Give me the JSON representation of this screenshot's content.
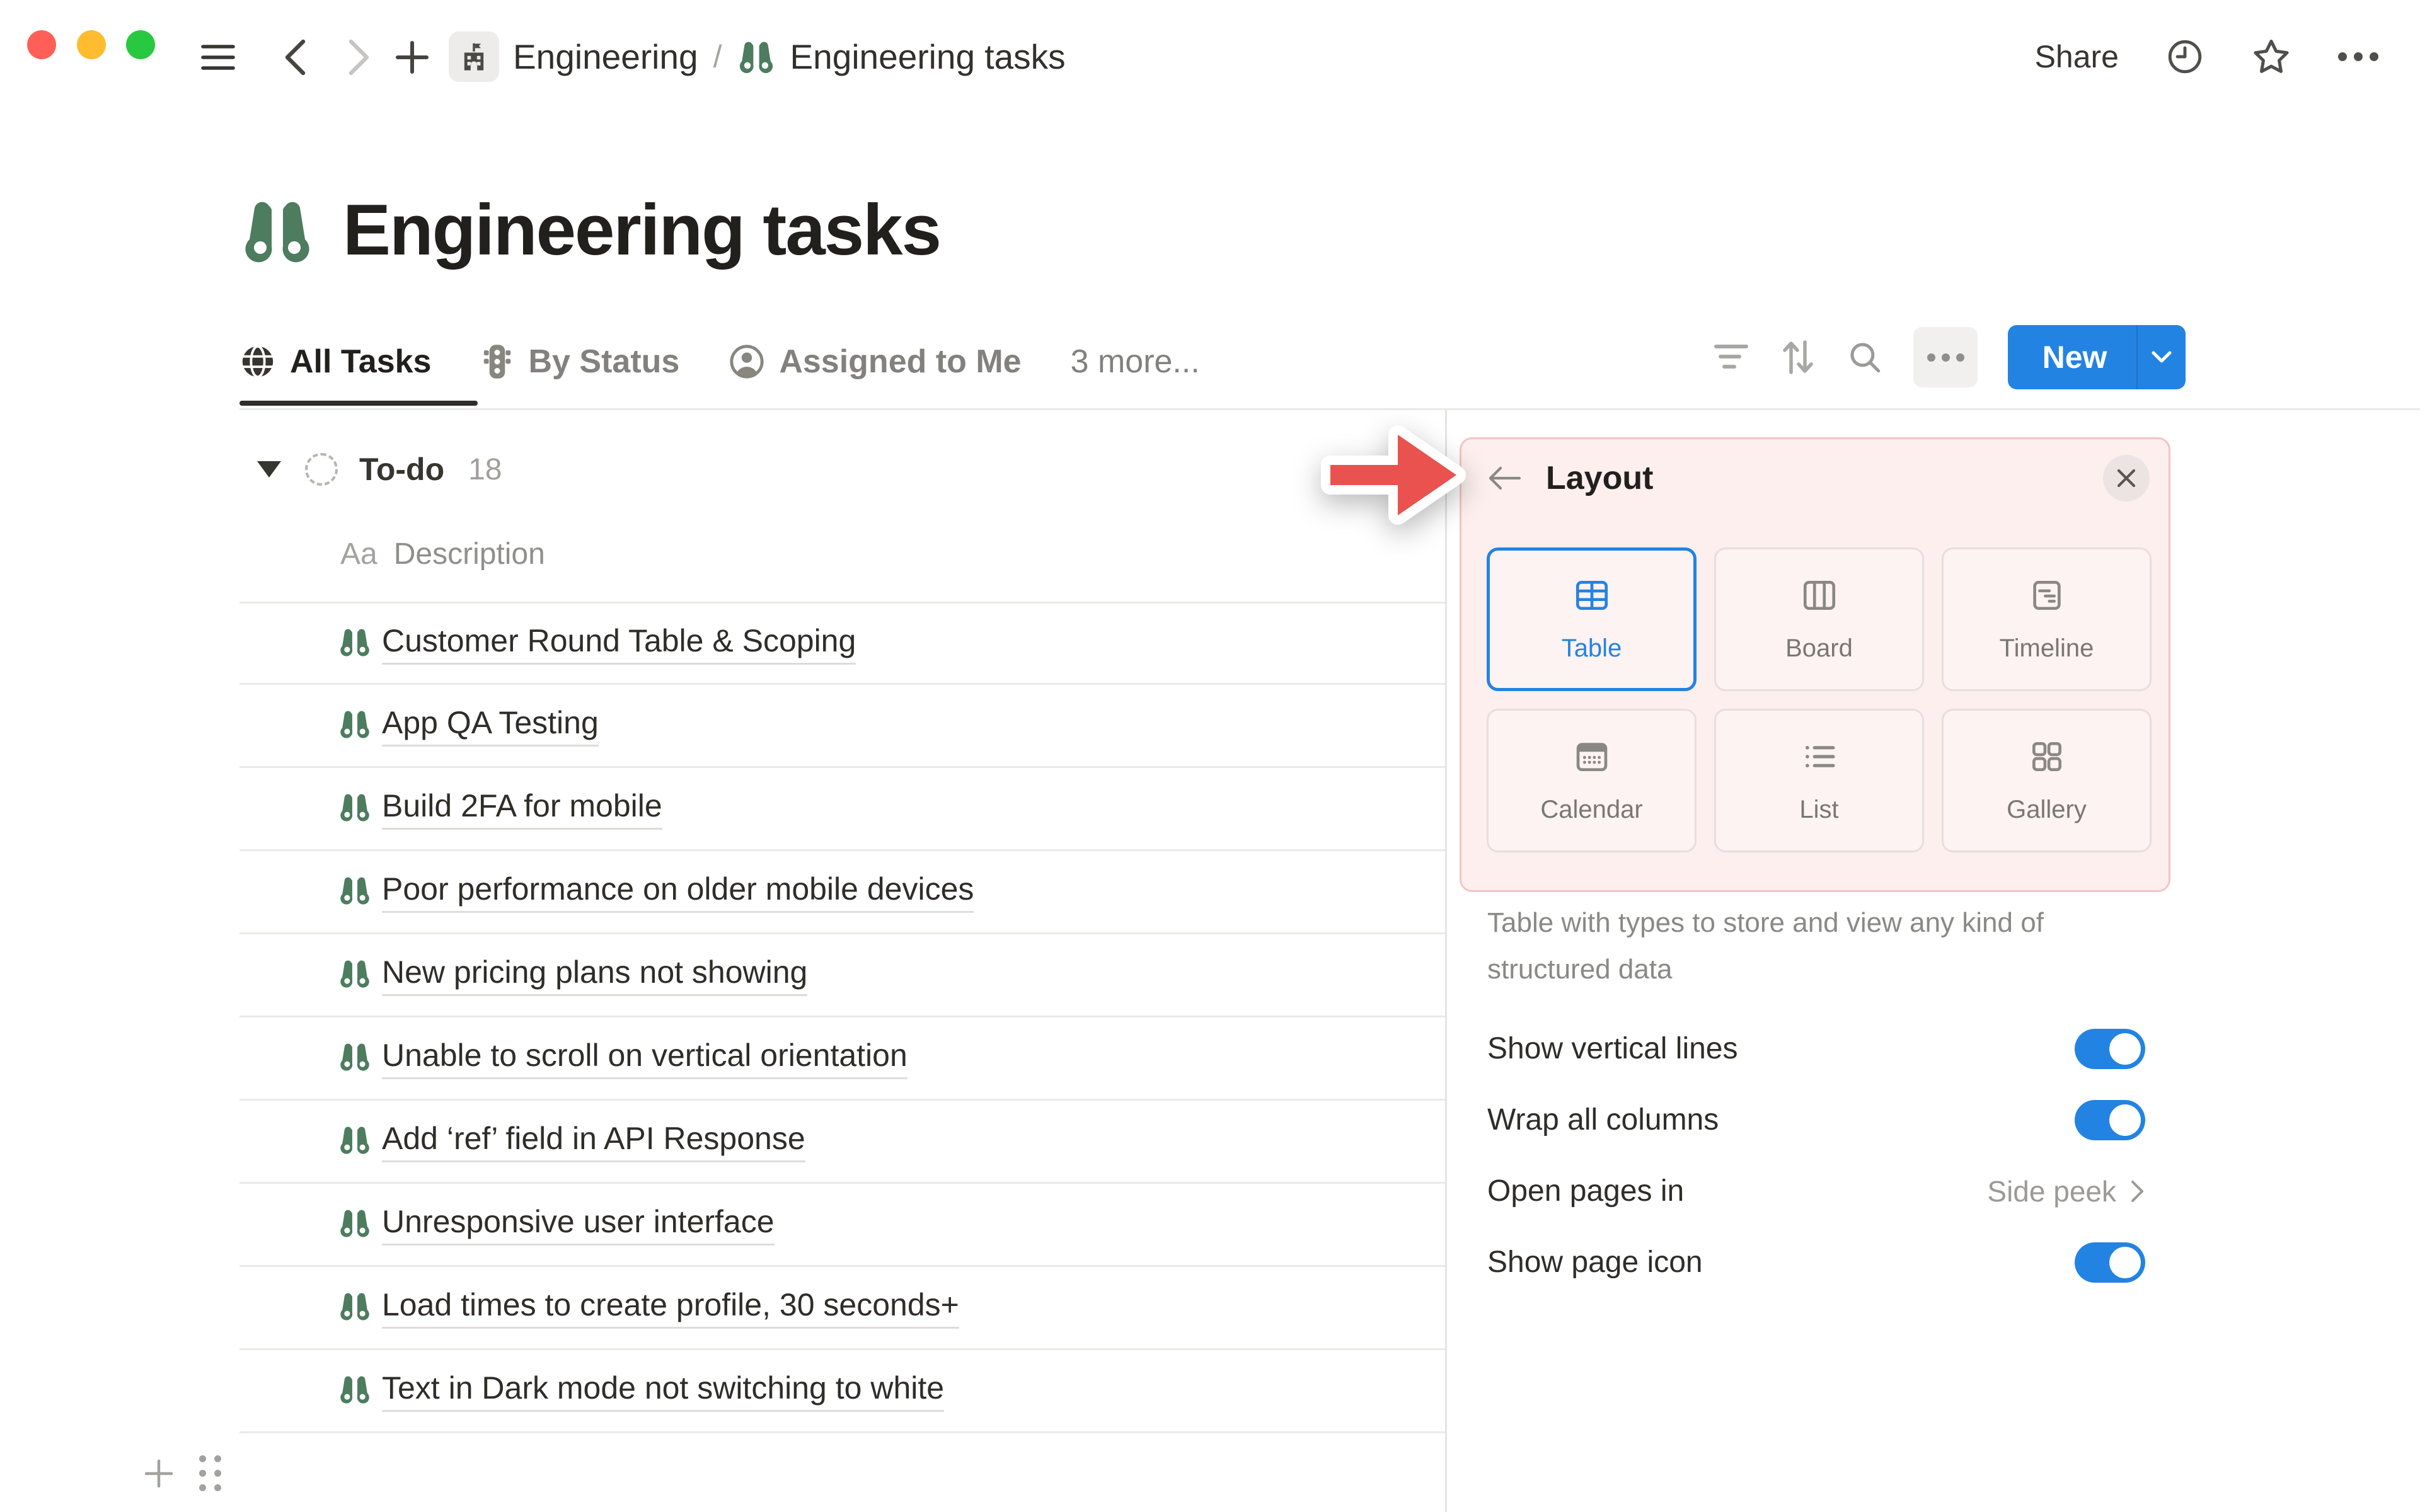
{
  "colors": {
    "accent_blue": "#2383e2",
    "icon_green": "#4d7c5f",
    "arrow_red": "#e9524e",
    "panel_pink_bg": "#fcefee",
    "panel_pink_border": "#f3c5c4",
    "text_dark": "#32302c",
    "text_gray": "#787774"
  },
  "topbar": {
    "breadcrumb": {
      "workspace": "Engineering",
      "separator": "/",
      "page": "Engineering tasks"
    },
    "share_label": "Share"
  },
  "page": {
    "title": "Engineering tasks",
    "icon": "binoculars-icon"
  },
  "tabs": [
    {
      "label": "All Tasks",
      "icon": "globe-icon",
      "active": true
    },
    {
      "label": "By Status",
      "icon": "traffic-light-icon",
      "active": false
    },
    {
      "label": "Assigned to Me",
      "icon": "person-circle-icon",
      "active": false
    },
    {
      "label": "3 more...",
      "icon": "",
      "active": false
    }
  ],
  "view_toolbar": {
    "new_label": "New"
  },
  "table": {
    "group": {
      "name": "To-do",
      "count": "18"
    },
    "column_header": {
      "type_glyph": "Aa",
      "label": "Description"
    },
    "rows": [
      {
        "title": "Customer Round Table & Scoping"
      },
      {
        "title": "App QA Testing"
      },
      {
        "title": "Build 2FA for mobile"
      },
      {
        "title": "Poor performance on older mobile devices"
      },
      {
        "title": "New pricing plans not showing"
      },
      {
        "title": "Unable to scroll on vertical orientation"
      },
      {
        "title": "Add ‘ref’ field in API Response"
      },
      {
        "title": "Unresponsive user interface"
      },
      {
        "title": "Load times to create profile, 30 seconds+"
      },
      {
        "title": "Text in Dark mode not switching to white"
      }
    ]
  },
  "layout_panel": {
    "title": "Layout",
    "options": [
      {
        "label": "Table",
        "selected": true
      },
      {
        "label": "Board",
        "selected": false
      },
      {
        "label": "Timeline",
        "selected": false
      },
      {
        "label": "Calendar",
        "selected": false
      },
      {
        "label": "List",
        "selected": false
      },
      {
        "label": "Gallery",
        "selected": false
      }
    ],
    "description": "Table with types to store and view any kind of structured data",
    "settings": [
      {
        "label": "Show vertical lines",
        "type": "toggle",
        "value": true
      },
      {
        "label": "Wrap all columns",
        "type": "toggle",
        "value": true
      },
      {
        "label": "Open pages in",
        "type": "link",
        "value": "Side peek"
      },
      {
        "label": "Show page icon",
        "type": "toggle",
        "value": true
      }
    ]
  }
}
